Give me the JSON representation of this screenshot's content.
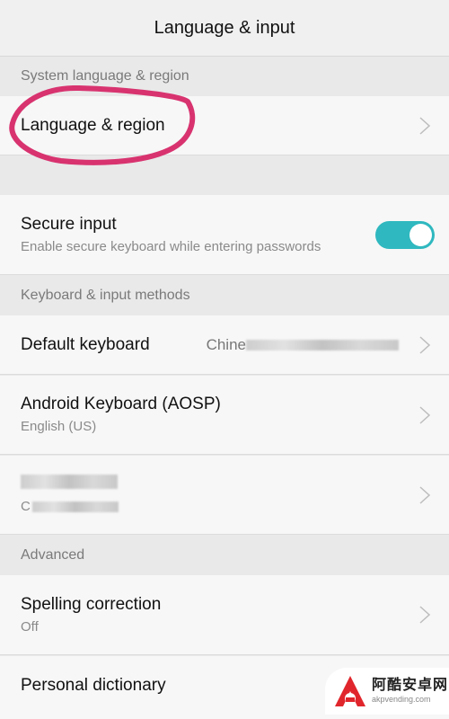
{
  "header": {
    "title": "Language & input"
  },
  "sections": {
    "system": {
      "label": "System language & region"
    },
    "keyboard": {
      "label": "Keyboard & input methods"
    },
    "advanced": {
      "label": "Advanced"
    }
  },
  "rows": {
    "language_region": {
      "title": "Language & region"
    },
    "secure_input": {
      "title": "Secure input",
      "subtitle": "Enable secure keyboard while entering passwords",
      "toggle_on": true
    },
    "default_keyboard": {
      "title": "Default keyboard",
      "value": "Chine"
    },
    "android_keyboard": {
      "title": "Android Keyboard (AOSP)",
      "subtitle": "English (US)"
    },
    "redacted_keyboard": {
      "title": "",
      "subtitle": "C"
    },
    "spelling_correction": {
      "title": "Spelling correction",
      "subtitle": "Off"
    },
    "personal_dictionary": {
      "title": "Personal dictionary"
    }
  },
  "colors": {
    "accent": "#2fb8bf",
    "annotation": "#d8336f",
    "watermark_red": "#e0262c"
  },
  "watermark": {
    "name": "阿酷安卓网",
    "url": "akpvending.com"
  }
}
